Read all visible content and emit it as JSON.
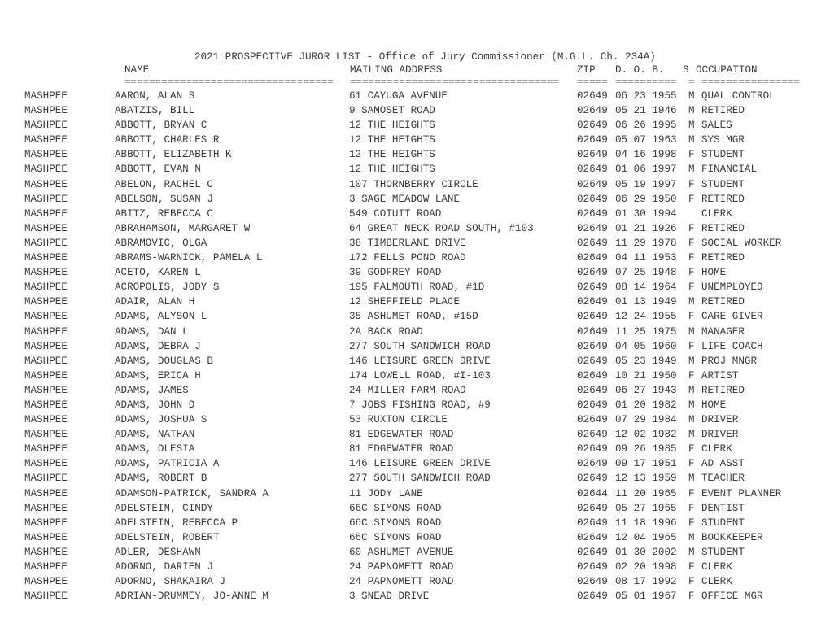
{
  "document": {
    "title": "2021 PROSPECTIVE JUROR LIST - Office of Jury Commissioner (M.G.L. Ch. 234A)",
    "headers": {
      "name": "NAME",
      "address": "MAILING ADDRESS",
      "zip": "ZIP",
      "dob": "D. O. B.",
      "sex": "S",
      "occupation": "OCCUPATION"
    },
    "separators": {
      "name": "==================================",
      "address": "==================================",
      "zip": "=====",
      "dob": "==========",
      "sex": "=",
      "occupation": "================"
    }
  },
  "rows": [
    {
      "town": "MASHPEE",
      "name": "AARON, ALAN S",
      "address": "61 CAYUGA AVENUE",
      "zip": "02649",
      "dob": "06 23 1955",
      "sex": "M",
      "occupation": "QUAL CONTROL"
    },
    {
      "town": "MASHPEE",
      "name": "ABATZIS, BILL",
      "address": "9 SAMOSET ROAD",
      "zip": "02649",
      "dob": "05 21 1946",
      "sex": "M",
      "occupation": "RETIRED"
    },
    {
      "town": "MASHPEE",
      "name": "ABBOTT, BRYAN C",
      "address": "12 THE HEIGHTS",
      "zip": "02649",
      "dob": "06 26 1995",
      "sex": "M",
      "occupation": "SALES"
    },
    {
      "town": "MASHPEE",
      "name": "ABBOTT, CHARLES R",
      "address": "12 THE HEIGHTS",
      "zip": "02649",
      "dob": "05 07 1963",
      "sex": "M",
      "occupation": "SYS MGR"
    },
    {
      "town": "MASHPEE",
      "name": "ABBOTT, ELIZABETH K",
      "address": "12 THE HEIGHTS",
      "zip": "02649",
      "dob": "04 16 1998",
      "sex": "F",
      "occupation": "STUDENT"
    },
    {
      "town": "MASHPEE",
      "name": "ABBOTT, EVAN N",
      "address": "12 THE HEIGHTS",
      "zip": "02649",
      "dob": "01 06 1997",
      "sex": "M",
      "occupation": "FINANCIAL"
    },
    {
      "town": "MASHPEE",
      "name": "ABELON, RACHEL C",
      "address": "107 THORNBERRY CIRCLE",
      "zip": "02649",
      "dob": "05 19 1997",
      "sex": "F",
      "occupation": "STUDENT"
    },
    {
      "town": "MASHPEE",
      "name": "ABELSON, SUSAN J",
      "address": "3 SAGE MEADOW LANE",
      "zip": "02649",
      "dob": "06 29 1950",
      "sex": "F",
      "occupation": "RETIRED"
    },
    {
      "town": "MASHPEE",
      "name": "ABITZ, REBECCA C",
      "address": "549 COTUIT ROAD",
      "zip": "02649",
      "dob": "01 30 1994",
      "sex": "",
      "occupation": "CLERK"
    },
    {
      "town": "MASHPEE",
      "name": "ABRAHAMSON, MARGARET W",
      "address": "64 GREAT NECK ROAD SOUTH, #103",
      "zip": "02649",
      "dob": "01 21 1926",
      "sex": "F",
      "occupation": "RETIRED"
    },
    {
      "town": "MASHPEE",
      "name": "ABRAMOVIC, OLGA",
      "address": "38 TIMBERLANE DRIVE",
      "zip": "02649",
      "dob": "11 29 1978",
      "sex": "F",
      "occupation": "SOCIAL WORKER"
    },
    {
      "town": "MASHPEE",
      "name": "ABRAMS-WARNICK, PAMELA L",
      "address": "172 FELLS POND ROAD",
      "zip": "02649",
      "dob": "04 11 1953",
      "sex": "F",
      "occupation": "RETIRED"
    },
    {
      "town": "MASHPEE",
      "name": "ACETO, KAREN L",
      "address": "39 GODFREY ROAD",
      "zip": "02649",
      "dob": "07 25 1948",
      "sex": "F",
      "occupation": "HOME"
    },
    {
      "town": "MASHPEE",
      "name": "ACROPOLIS, JODY S",
      "address": "195 FALMOUTH ROAD, #1D",
      "zip": "02649",
      "dob": "08 14 1964",
      "sex": "F",
      "occupation": "UNEMPLOYED"
    },
    {
      "town": "MASHPEE",
      "name": "ADAIR, ALAN H",
      "address": "12 SHEFFIELD PLACE",
      "zip": "02649",
      "dob": "01 13 1949",
      "sex": "M",
      "occupation": "RETIRED"
    },
    {
      "town": "MASHPEE",
      "name": "ADAMS, ALYSON L",
      "address": "35 ASHUMET ROAD, #15D",
      "zip": "02649",
      "dob": "12 24 1955",
      "sex": "F",
      "occupation": "CARE GIVER"
    },
    {
      "town": "MASHPEE",
      "name": "ADAMS, DAN L",
      "address": "2A BACK ROAD",
      "zip": "02649",
      "dob": "11 25 1975",
      "sex": "M",
      "occupation": "MANAGER"
    },
    {
      "town": "MASHPEE",
      "name": "ADAMS, DEBRA J",
      "address": "277 SOUTH SANDWICH ROAD",
      "zip": "02649",
      "dob": "04 05 1960",
      "sex": "F",
      "occupation": "LIFE COACH"
    },
    {
      "town": "MASHPEE",
      "name": "ADAMS, DOUGLAS B",
      "address": "146 LEISURE GREEN DRIVE",
      "zip": "02649",
      "dob": "05 23 1949",
      "sex": "M",
      "occupation": "PROJ MNGR"
    },
    {
      "town": "MASHPEE",
      "name": "ADAMS, ERICA H",
      "address": "174 LOWELL ROAD, #I-103",
      "zip": "02649",
      "dob": "10 21 1950",
      "sex": "F",
      "occupation": "ARTIST"
    },
    {
      "town": "MASHPEE",
      "name": "ADAMS, JAMES",
      "address": "24 MILLER FARM ROAD",
      "zip": "02649",
      "dob": "06 27 1943",
      "sex": "M",
      "occupation": "RETIRED"
    },
    {
      "town": "MASHPEE",
      "name": "ADAMS, JOHN D",
      "address": "7 JOBS FISHING ROAD, #9",
      "zip": "02649",
      "dob": "01 20 1982",
      "sex": "M",
      "occupation": "HOME"
    },
    {
      "town": "MASHPEE",
      "name": "ADAMS, JOSHUA S",
      "address": "53 RUXTON CIRCLE",
      "zip": "02649",
      "dob": "07 29 1984",
      "sex": "M",
      "occupation": "DRIVER"
    },
    {
      "town": "MASHPEE",
      "name": "ADAMS, NATHAN",
      "address": "81 EDGEWATER ROAD",
      "zip": "02649",
      "dob": "12 02 1982",
      "sex": "M",
      "occupation": "DRIVER"
    },
    {
      "town": "MASHPEE",
      "name": "ADAMS, OLESIA",
      "address": "81 EDGEWATER ROAD",
      "zip": "02649",
      "dob": "09 26 1985",
      "sex": "F",
      "occupation": "CLERK"
    },
    {
      "town": "MASHPEE",
      "name": "ADAMS, PATRICIA A",
      "address": "146 LEISURE GREEN DRIVE",
      "zip": "02649",
      "dob": "09 17 1951",
      "sex": "F",
      "occupation": "AD ASST"
    },
    {
      "town": "MASHPEE",
      "name": "ADAMS, ROBERT B",
      "address": "277 SOUTH SANDWICH ROAD",
      "zip": "02649",
      "dob": "12 13 1959",
      "sex": "M",
      "occupation": "TEACHER"
    },
    {
      "town": "MASHPEE",
      "name": "ADAMSON-PATRICK, SANDRA A",
      "address": "11 JODY LANE",
      "zip": "02644",
      "dob": "11 20 1965",
      "sex": "F",
      "occupation": "EVENT PLANNER"
    },
    {
      "town": "MASHPEE",
      "name": "ADELSTEIN, CINDY",
      "address": "66C SIMONS ROAD",
      "zip": "02649",
      "dob": "05 27 1965",
      "sex": "F",
      "occupation": "DENTIST"
    },
    {
      "town": "MASHPEE",
      "name": "ADELSTEIN, REBECCA P",
      "address": "66C SIMONS ROAD",
      "zip": "02649",
      "dob": "11 18 1996",
      "sex": "F",
      "occupation": "STUDENT"
    },
    {
      "town": "MASHPEE",
      "name": "ADELSTEIN, ROBERT",
      "address": "66C SIMONS ROAD",
      "zip": "02649",
      "dob": "12 04 1965",
      "sex": "M",
      "occupation": "BOOKKEEPER"
    },
    {
      "town": "MASHPEE",
      "name": "ADLER, DESHAWN",
      "address": "60 ASHUMET AVENUE",
      "zip": "02649",
      "dob": "01 30 2002",
      "sex": "M",
      "occupation": "STUDENT"
    },
    {
      "town": "MASHPEE",
      "name": "ADORNO, DARIEN J",
      "address": "24 PAPNOMETT ROAD",
      "zip": "02649",
      "dob": "02 20 1998",
      "sex": "F",
      "occupation": "CLERK"
    },
    {
      "town": "MASHPEE",
      "name": "ADORNO, SHAKAIRA J",
      "address": "24 PAPNOMETT ROAD",
      "zip": "02649",
      "dob": "08 17 1992",
      "sex": "F",
      "occupation": "CLERK"
    },
    {
      "town": "MASHPEE",
      "name": "ADRIAN-DRUMMEY, JO-ANNE M",
      "address": "3 SNEAD DRIVE",
      "zip": "02649",
      "dob": "05 01 1967",
      "sex": "F",
      "occupation": "OFFICE MGR"
    }
  ]
}
